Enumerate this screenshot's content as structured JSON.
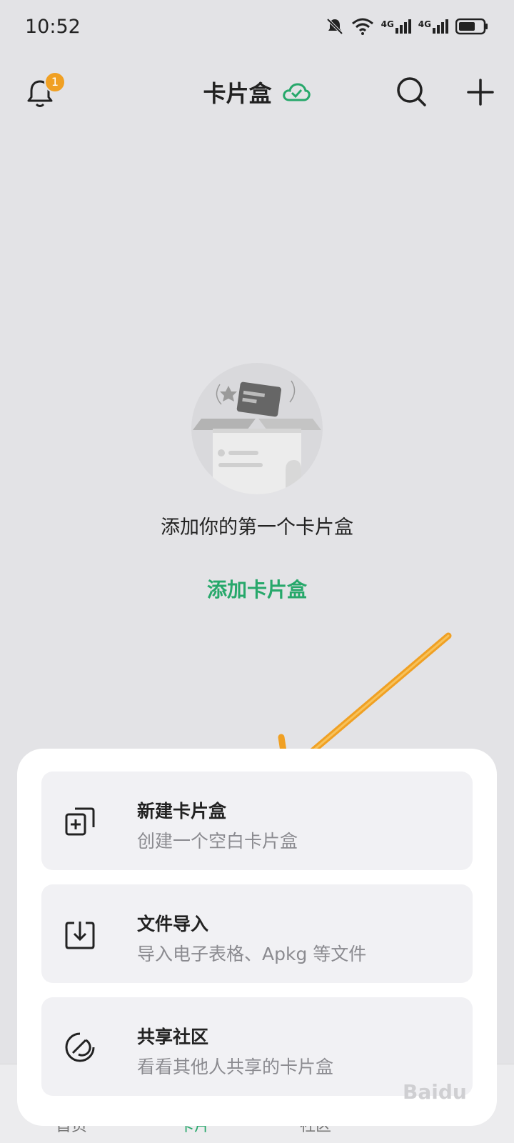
{
  "status": {
    "time": "10:52",
    "network1": "4G",
    "network2": "4G"
  },
  "header": {
    "title": "卡片盒",
    "notification_count": "1"
  },
  "empty_state": {
    "message": "添加你的第一个卡片盒",
    "action": "添加卡片盒"
  },
  "sheet": {
    "options": [
      {
        "title": "新建卡片盒",
        "subtitle": "创建一个空白卡片盒",
        "icon": "new-box-icon"
      },
      {
        "title": "文件导入",
        "subtitle": "导入电子表格、Apkg 等文件",
        "icon": "import-icon"
      },
      {
        "title": "共享社区",
        "subtitle": "看看其他人共享的卡片盒",
        "icon": "community-icon"
      }
    ]
  },
  "bottom_nav": {
    "items": [
      "首页",
      "卡片",
      "社区"
    ]
  },
  "colors": {
    "accent": "#27a86b",
    "badge": "#f0a023",
    "arrow": "#f0a023"
  }
}
